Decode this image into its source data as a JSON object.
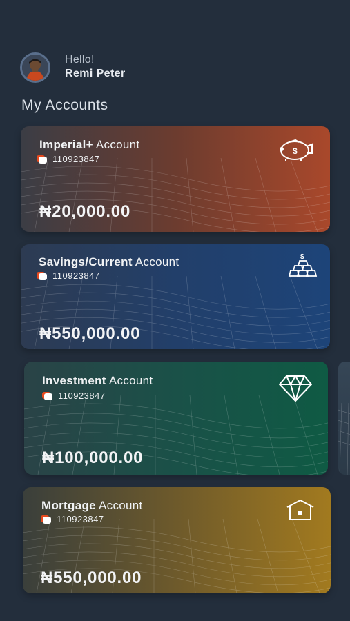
{
  "greeting": {
    "hello": "Hello!",
    "user_name": "Remi Peter"
  },
  "section_title": "My Accounts",
  "accounts": [
    {
      "name": "Imperial+",
      "suffix": "Account",
      "number": "110923847",
      "balance": "₦20,000.00",
      "icon": "piggy-bank-icon",
      "colors": [
        "#3b3d45",
        "#a9482b"
      ]
    },
    {
      "name": "Savings/Current",
      "suffix": "Account",
      "number": "110923847",
      "balance": "₦550,000.00",
      "icon": "gold-bars-icon",
      "colors": [
        "#2d3b52",
        "#1d4479"
      ]
    },
    {
      "name": "Investment",
      "suffix": "Account",
      "number": "110923847",
      "balance": "₦100,000.00",
      "icon": "diamond-icon",
      "colors": [
        "#2a4347",
        "#0f5a44"
      ]
    },
    {
      "name": "Mortgage",
      "suffix": "Account",
      "number": "110923847",
      "balance": "₦550,000.00",
      "icon": "house-icon",
      "colors": [
        "#3a3f3b",
        "#a27a1f"
      ]
    }
  ]
}
